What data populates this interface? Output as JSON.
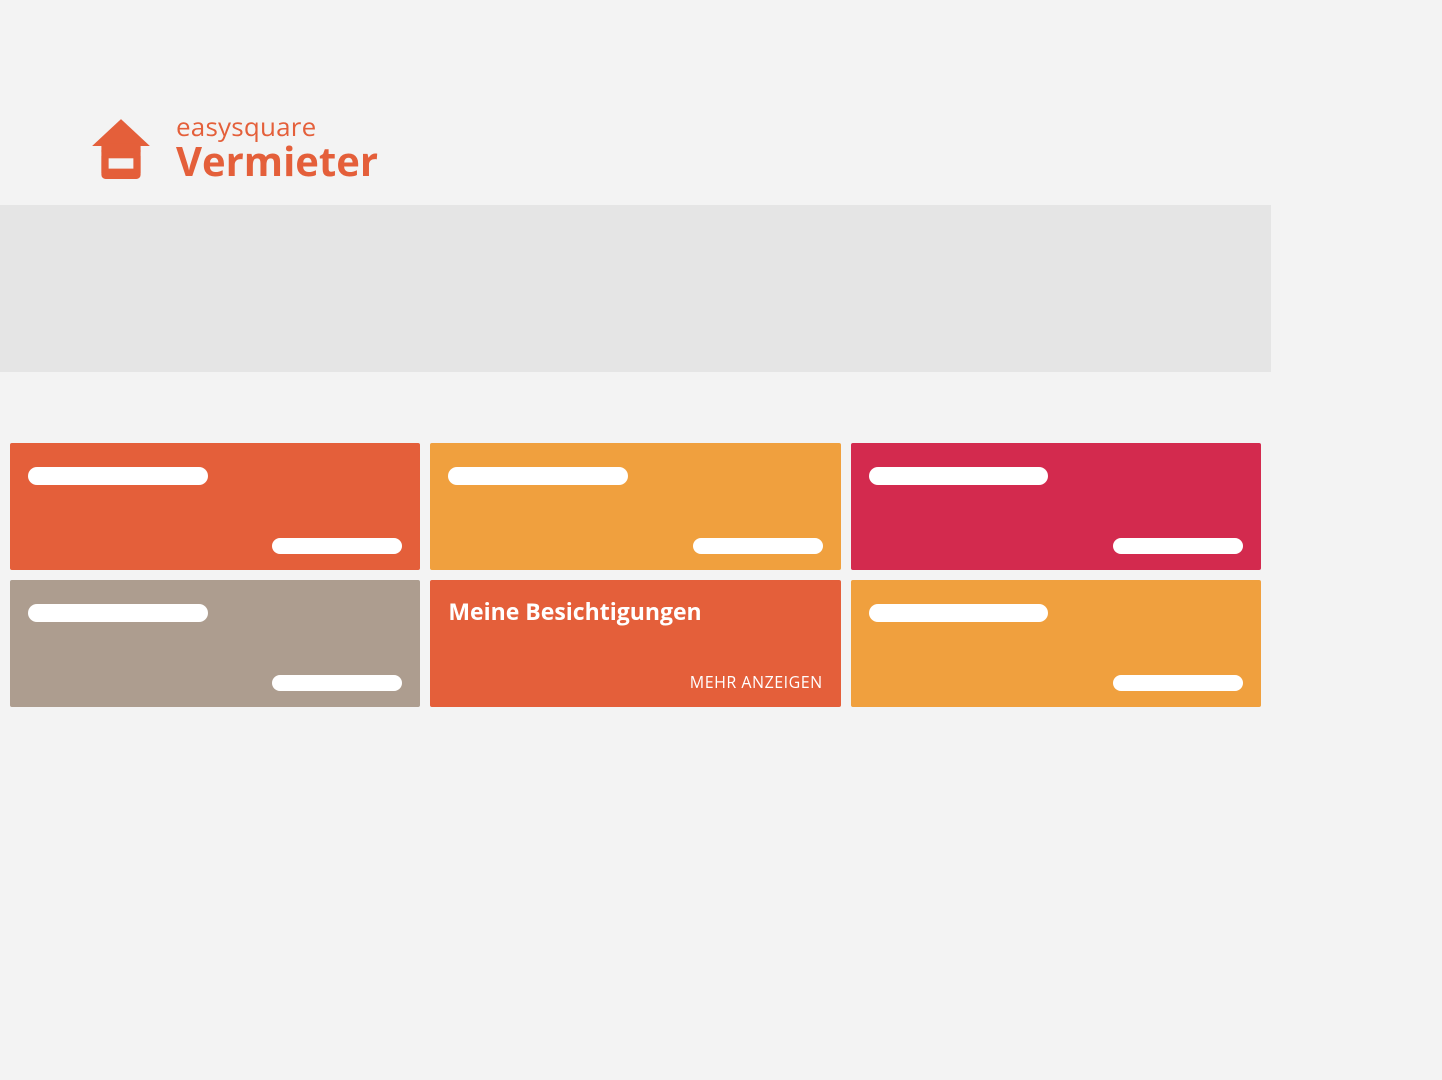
{
  "brand": {
    "line1": "easysquare",
    "line2": "Vermieter",
    "color": "#e45f3a"
  },
  "colors": {
    "orange": "#e45f3a",
    "yellow": "#f0a03e",
    "crimson": "#d32a4e",
    "taupe": "#ad9d8f"
  },
  "tiles": [
    {
      "bg": "orange",
      "title": "",
      "footer": ""
    },
    {
      "bg": "yellow",
      "title": "",
      "footer": ""
    },
    {
      "bg": "crimson",
      "title": "",
      "footer": ""
    },
    {
      "bg": "taupe",
      "title": "",
      "footer": ""
    },
    {
      "bg": "orange",
      "title": "Meine Besichtigungen",
      "footer": "MEHR ANZEIGEN"
    },
    {
      "bg": "yellow",
      "title": "",
      "footer": ""
    }
  ]
}
